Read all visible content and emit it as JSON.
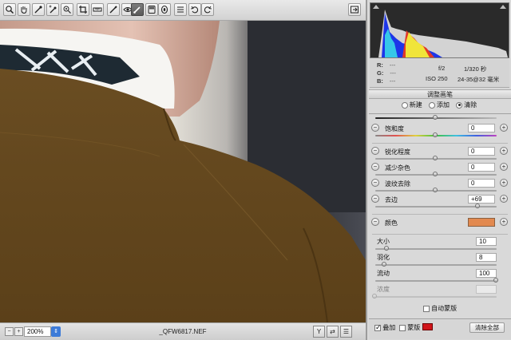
{
  "toolbar": {
    "tools": [
      {
        "name": "zoom-tool",
        "icon": "magnifier-icon"
      },
      {
        "name": "hand-tool",
        "icon": "hand-icon"
      },
      {
        "name": "white-balance-tool",
        "icon": "eyedropper-icon"
      },
      {
        "name": "color-sampler-tool",
        "icon": "eyedropper-plus-icon"
      },
      {
        "name": "targeted-adjustment-tool",
        "icon": "target-icon"
      },
      {
        "name": "crop-tool",
        "icon": "crop-icon"
      },
      {
        "name": "straighten-tool",
        "icon": "level-icon"
      },
      {
        "name": "spot-removal-tool",
        "icon": "brush-heal-icon"
      },
      {
        "name": "red-eye-tool",
        "icon": "eye-icon"
      },
      {
        "name": "adjustment-brush-tool",
        "icon": "brush-icon",
        "active": true
      },
      {
        "name": "graduated-filter-tool",
        "icon": "gradient-icon"
      },
      {
        "name": "radial-filter-tool",
        "icon": "radial-icon"
      },
      {
        "name": "preferences-tool",
        "icon": "list-icon"
      },
      {
        "name": "rotate-ccw-tool",
        "icon": "rotate-ccw-icon"
      },
      {
        "name": "rotate-cw-tool",
        "icon": "rotate-cw-icon"
      }
    ]
  },
  "status": {
    "zoom": "200%",
    "filename": "_QFW6817.NEF"
  },
  "info": {
    "r_label": "R:",
    "g_label": "G:",
    "b_label": "B:",
    "r_value": "---",
    "g_value": "---",
    "b_value": "---",
    "aperture": "f/2",
    "shutter": "1/320 秒",
    "iso": "ISO 250",
    "lens": "24-35@32 毫米"
  },
  "panel": {
    "title": "调整画笔",
    "modes": [
      {
        "label": "新建",
        "selected": false
      },
      {
        "label": "添加",
        "selected": false
      },
      {
        "label": "清除",
        "selected": true
      }
    ],
    "sliders": [
      {
        "label": "饱和度",
        "value": "0",
        "level": 0.5
      },
      {
        "label": "锐化程度",
        "value": "0",
        "level": 0.5
      },
      {
        "label": "减少杂色",
        "value": "0",
        "level": 0.5
      },
      {
        "label": "波纹去除",
        "value": "0",
        "level": 0.5
      },
      {
        "label": "去边",
        "value": "+69",
        "level": 0.85
      }
    ],
    "color_label": "颜色",
    "color_swatch": "#e2894f",
    "brush": [
      {
        "label": "大小",
        "value": "10",
        "level": 0.1
      },
      {
        "label": "羽化",
        "value": "8",
        "level": 0.08
      },
      {
        "label": "流动",
        "value": "100",
        "level": 1.0
      },
      {
        "label": "浓度",
        "value": "",
        "level": 0.0
      }
    ],
    "auto_mask_label": "自动蒙版",
    "auto_mask_checked": false
  },
  "footer": {
    "overlay_label": "叠加",
    "overlay_checked": true,
    "mask_label": "蒙版",
    "mask_checked": false,
    "mask_color": "#d0141a",
    "clear_all_label": "清除全部"
  }
}
